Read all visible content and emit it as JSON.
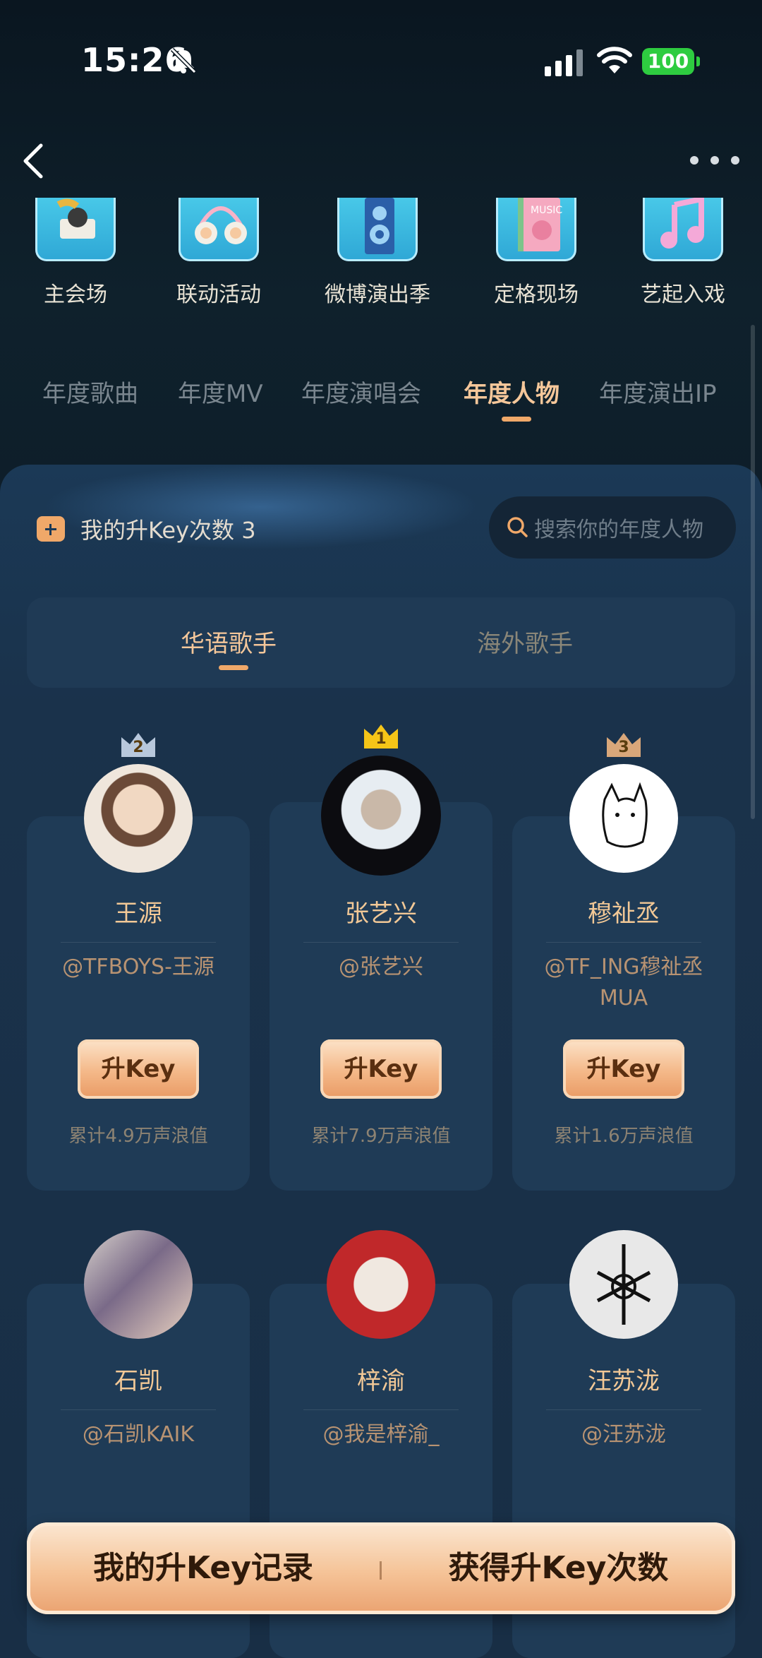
{
  "status": {
    "time": "15:26",
    "battery": "100"
  },
  "categories": [
    {
      "label": "主会场",
      "icon": "gramophone-icon"
    },
    {
      "label": "联动活动",
      "icon": "headphones-icon"
    },
    {
      "label": "微博演出季",
      "icon": "speaker-icon"
    },
    {
      "label": "定格现场",
      "icon": "music-book-icon"
    },
    {
      "label": "艺起入戏",
      "icon": "music-note-icon"
    }
  ],
  "tabs": [
    "年度歌曲",
    "年度MV",
    "年度演唱会",
    "年度人物",
    "年度演出IP"
  ],
  "active_tab": "年度人物",
  "key_count_label": "我的升Key次数 3",
  "search": {
    "placeholder": "搜索你的年度人物"
  },
  "subtabs": [
    "华语歌手",
    "海外歌手"
  ],
  "cards": [
    {
      "rank": "2",
      "name": "王源",
      "handle": "@TFBOYS-王源",
      "button": "升Key",
      "total": "累计4.9万声浪值"
    },
    {
      "rank": "1",
      "name": "张艺兴",
      "handle": "@张艺兴",
      "button": "升Key",
      "total": "累计7.9万声浪值"
    },
    {
      "rank": "3",
      "name": "穆祉丞",
      "handle": "@TF_ING穆祉丞MUA",
      "button": "升Key",
      "total": "累计1.6万声浪值"
    },
    {
      "name": "石凯",
      "handle": "@石凯KAIK"
    },
    {
      "name": "梓渝",
      "handle": "@我是梓渝_"
    },
    {
      "name": "汪苏泷",
      "handle": "@汪苏泷"
    }
  ],
  "bottom": {
    "records": "我的升Key记录",
    "get_more": "获得升Key次数"
  },
  "colors": {
    "accent": "#f5c79a",
    "gold_crown": "#f5c518",
    "silver_crown": "#b8c8dc",
    "bronze_crown": "#d9a77a"
  }
}
